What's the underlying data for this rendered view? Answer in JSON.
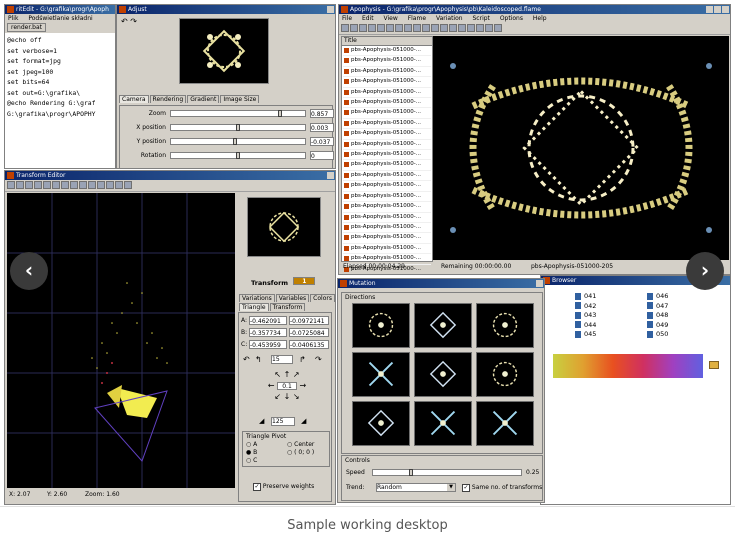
{
  "editor_window": {
    "title": "ritEdit - G:\\grafika\\progr\\Apoph",
    "menu": [
      "Plik",
      "Podświetlanie składni"
    ],
    "file_tab": "render.bat",
    "lines": [
      "@echo off",
      "set verbose=1",
      "set format=jpg",
      "set jpeg=100",
      "set bits=64",
      "set out=G:\\grafika\\",
      "@echo Rendering G:\\graf",
      "G:\\grafika\\progr\\APOPHY"
    ]
  },
  "adjust_window": {
    "title": "Adjust",
    "tabs": [
      "Camera",
      "Rendering",
      "Gradient",
      "Image Size"
    ],
    "sliders": [
      {
        "label": "Zoom",
        "value": "0.857",
        "level": 0.82
      },
      {
        "label": "X position",
        "value": "0.003",
        "level": 0.5
      },
      {
        "label": "Y position",
        "value": "-0.037",
        "level": 0.48
      },
      {
        "label": "Rotation",
        "value": "0",
        "level": 0.5
      }
    ]
  },
  "apophysis_window": {
    "title": "Apophysis - G:\\grafika\\progr\\Apophysis\\pb\\Kaleidoscoped.flame",
    "menu": [
      "File",
      "Edit",
      "View",
      "Flame",
      "Variation",
      "Script",
      "Options",
      "Help"
    ],
    "list_header": "Title",
    "list_items": [
      "pbs-Apophysis-051000-...",
      "pbs-Apophysis-051000-...",
      "pbs-Apophysis-051000-...",
      "pbs-Apophysis-051000-...",
      "pbs-Apophysis-051000-...",
      "pbs-Apophysis-051000-...",
      "pbs-Apophysis-051000-...",
      "pbs-Apophysis-051000-...",
      "pbs-Apophysis-051000-...",
      "pbs-Apophysis-051000-...",
      "pbs-Apophysis-051000-...",
      "pbs-Apophysis-051000-...",
      "pbs-Apophysis-051000-...",
      "pbs-Apophysis-051000-...",
      "pbs-Apophysis-051000-...",
      "pbs-Apophysis-051000-...",
      "pbs-Apophysis-051000-...",
      "pbs-Apophysis-051000-...",
      "pbs-Apophysis-051000-...",
      "pbs-Apophysis-051000-...",
      "pbs-Apophysis-051000-...",
      "pbs-Apophysis-051000-...",
      "pbs-Apophysis-051000-..."
    ],
    "status_elapsed": "Elapsed 00:00:04.29",
    "status_remaining": "Remaining 00:00:00.00",
    "status_name": "pbs-Apophysis-051000-205"
  },
  "transform_editor": {
    "title": "Transform Editor",
    "status_x": "X: 2.07",
    "status_y": "Y: 2.60",
    "status_zoom": "Zoom: 1.60",
    "transform_label": "Transform",
    "transform_value": "1",
    "tabs_row1": [
      "Variations",
      "Variables",
      "Colors"
    ],
    "tabs_row2": [
      "Triangle",
      "Transform"
    ],
    "coords": [
      {
        "label": "A:",
        "x": "-0.462091",
        "y": "-0.0972141"
      },
      {
        "label": "B:",
        "x": "-0.357734",
        "y": "-0.0725084"
      },
      {
        "label": "C:",
        "x": "-0.453959",
        "y": "-0.0406135"
      }
    ],
    "rotate_value": "15",
    "move_value": "0.1",
    "scale_value": "125",
    "pivot_title": "Triangle Pivot",
    "pivot_options": [
      "A",
      "Center",
      "B",
      "( 0; 0 )",
      "C"
    ],
    "preserve_label": "Preserve weights"
  },
  "mutation_window": {
    "title": "Mutation",
    "directions_label": "Directions",
    "controls_label": "Controls",
    "speed_label": "Speed",
    "speed_value": "0.25",
    "speed_level": 0.25,
    "trend_label": "Trend:",
    "trend_value": "Random",
    "same_no_label": "Same no. of transforms"
  },
  "browser_window": {
    "title": "Browser",
    "files_col1": [
      "041",
      "042",
      "043",
      "044",
      "045"
    ],
    "files_col2": [
      "046",
      "047",
      "048",
      "049",
      "050"
    ]
  },
  "nav": {
    "prev": "‹",
    "next": "›"
  },
  "caption": "Sample working desktop"
}
